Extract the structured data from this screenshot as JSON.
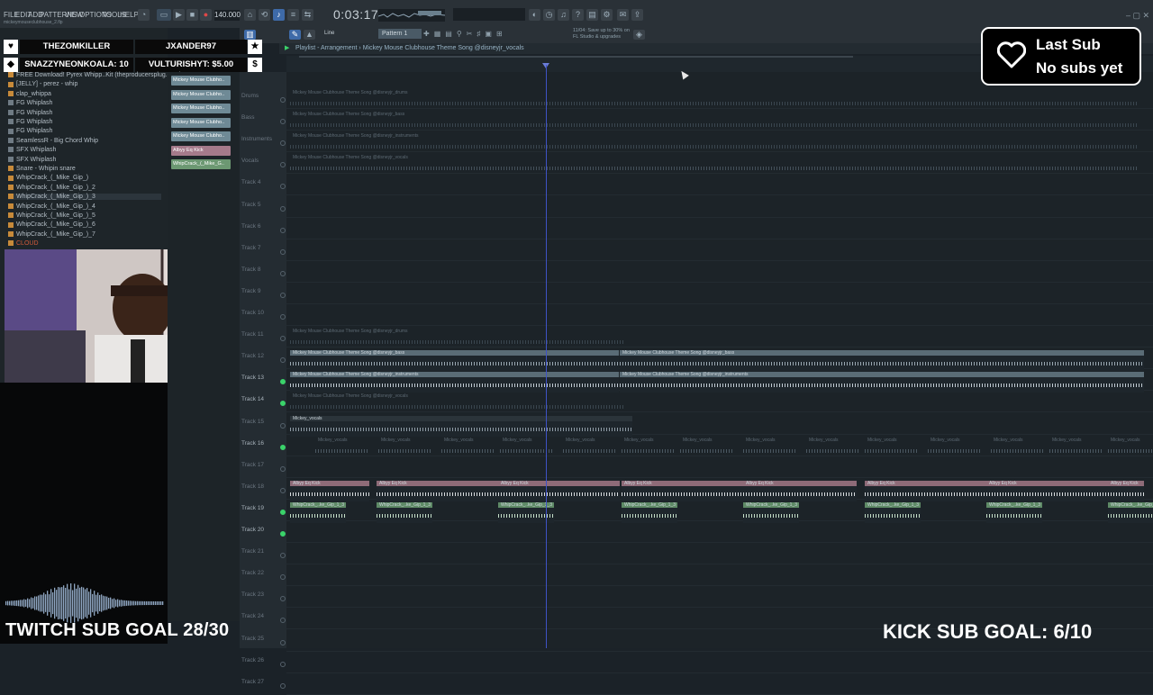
{
  "menu": {
    "items": [
      "FILE",
      "EDIT",
      "ADD",
      "PATTERNS",
      "VIEW",
      "OPTIONS",
      "TOOLS",
      "HELP"
    ]
  },
  "transport": {
    "tempo": "140.000",
    "time": "0:03:17",
    "pattern": "Pattern 1",
    "snap": "Line"
  },
  "project": {
    "file": "mickeymouseclubhouse_2.flp"
  },
  "notice": {
    "line1": "11/04: Save up to 30% on",
    "line2": "FL Studio & upgrades"
  },
  "playlist": {
    "title": "Playlist - Arrangement  ›  Mickey Mouse Clubhouse Theme Song  @disneyjr_vocals"
  },
  "alert": {
    "title": "Last Sub",
    "subtitle": "No subs yet"
  },
  "donors": {
    "top1": "THEZOMKILLER",
    "top2": "JXANDER97",
    "bits_line": "SNAZZYNEONKOALA: 10",
    "tip_line": "VULTURISHYT: $5.00",
    "heart": "♥",
    "dollar": "$",
    "star": "★",
    "gem": "◆"
  },
  "browser": {
    "items": [
      "FREE Download! Pyrex Whipp..Kit (theproducersplug.com)",
      "[JELLY] - perez - whip",
      "clap_whippa",
      "FG Whiplash",
      "FG Whiplash",
      "FG Whiplash",
      "FG Whiplash",
      "SeamlessR - Big Chord Whip",
      "SFX Whiplash",
      "SFX Whiplash",
      "Snare - Whipin snare",
      "WhipCrack_(_Mike_Gip_)",
      "WhipCrack_(_Mike_Gip_)_2",
      "WhipCrack_(_Mike_Gip_)_3",
      "WhipCrack_(_Mike_Gip_)_4",
      "WhipCrack_(_Mike_Gip_)_5",
      "WhipCrack_(_Mike_Gip_)_6",
      "WhipCrack_(_Mike_Gip_)_7",
      "CLOUD"
    ]
  },
  "channels": [
    {
      "label": "Mickey Mouse Clubho..",
      "color": "#6f8a96"
    },
    {
      "label": "Mickey Mouse Clubho..",
      "color": "#6f8a96"
    },
    {
      "label": "Mickey Mouse Clubho..",
      "color": "#6f8a96"
    },
    {
      "label": "Mickey Mouse Clubho..",
      "color": "#6f8a96"
    },
    {
      "label": "Mickey Mouse Clubho..",
      "color": "#6f8a96"
    },
    {
      "label": "Albyy Eq Kick",
      "color": "#a57a8a"
    },
    {
      "label": "WhipCrack_(_Mike_G..",
      "color": "#6c9872"
    }
  ],
  "tracks": [
    "Drums",
    "Bass",
    "Instruments",
    "Vocals",
    "Track 4",
    "Track 5",
    "Track 6",
    "Track 7",
    "Track 8",
    "Track 9",
    "Track 10",
    "Track 11",
    "Track 12",
    "Track 13",
    "Track 14",
    "Track 15",
    "Track 16",
    "Track 17",
    "Track 18",
    "Track 19",
    "Track 20",
    "Track 21",
    "Track 22",
    "Track 23",
    "Track 24",
    "Track 25",
    "Track 26",
    "Track 27"
  ],
  "clips": {
    "drums": "Mickey Mouse Clubhouse Theme Song  @disneyjr_drums",
    "bass": "Mickey Mouse Clubhouse Theme Song  @disneyjr_bass",
    "instruments": "Mickey Mouse Clubhouse Theme Song  @disneyjr_instruments",
    "vocals": "Mickey Mouse Clubhouse Theme Song  @disneyjr_vocals",
    "kick": "Albyy Eq Kick",
    "whip": "WhipCrack_..ke_Gip_1_3",
    "vocal_chop": "Mickey_vocals"
  },
  "goals": {
    "twitch": "TWITCH SUB GOAL 28/30",
    "kick": "KICK SUB GOAL: 6/10"
  },
  "colors": {
    "accent": "#3f53c6",
    "kick_clip": "#8e6b78",
    "whip_clip": "#5e8a66",
    "audio_clip": "#5a6c76",
    "active_led": "#3bd36a"
  }
}
